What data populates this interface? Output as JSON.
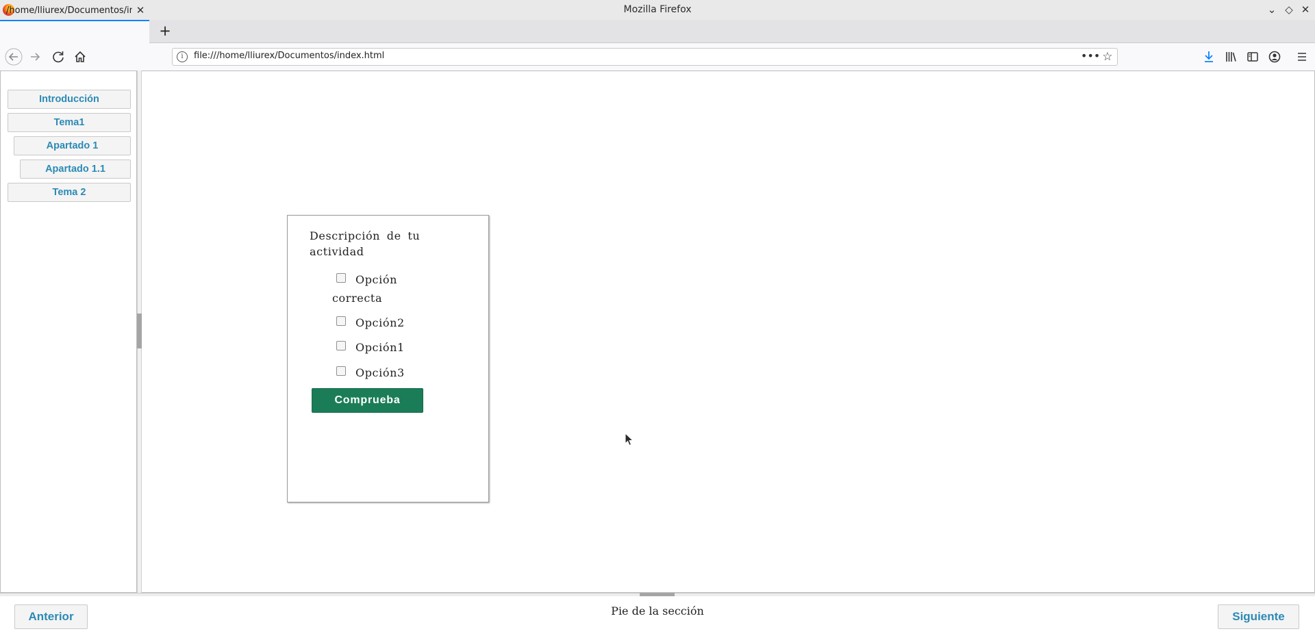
{
  "window": {
    "title": "Mozilla Firefox"
  },
  "tab": {
    "title": "/home/lliurex/Documentos/index.html"
  },
  "urlbar": {
    "url": "file:///home/lliurex/Documentos/index.html"
  },
  "sidebar": {
    "items": [
      {
        "label": "Introducción"
      },
      {
        "label": "Tema1"
      },
      {
        "label": "Apartado 1"
      },
      {
        "label": "Apartado 1.1"
      },
      {
        "label": "Tema 2"
      }
    ]
  },
  "activity": {
    "description": "Descripción de tu actividad",
    "options": [
      {
        "label": "Opción correcta",
        "checked": false
      },
      {
        "label": "Opción2",
        "checked": false
      },
      {
        "label": "Opción1",
        "checked": false
      },
      {
        "label": "Opción3",
        "checked": false
      }
    ],
    "check_label": "Comprueba"
  },
  "footer": {
    "prev_label": "Anterior",
    "text": "Pie de la sección",
    "next_label": "Siguiente"
  },
  "colors": {
    "link_blue": "#2b8ab5",
    "check_button_green": "#1b7d57",
    "tab_accent": "#0a84ff"
  }
}
